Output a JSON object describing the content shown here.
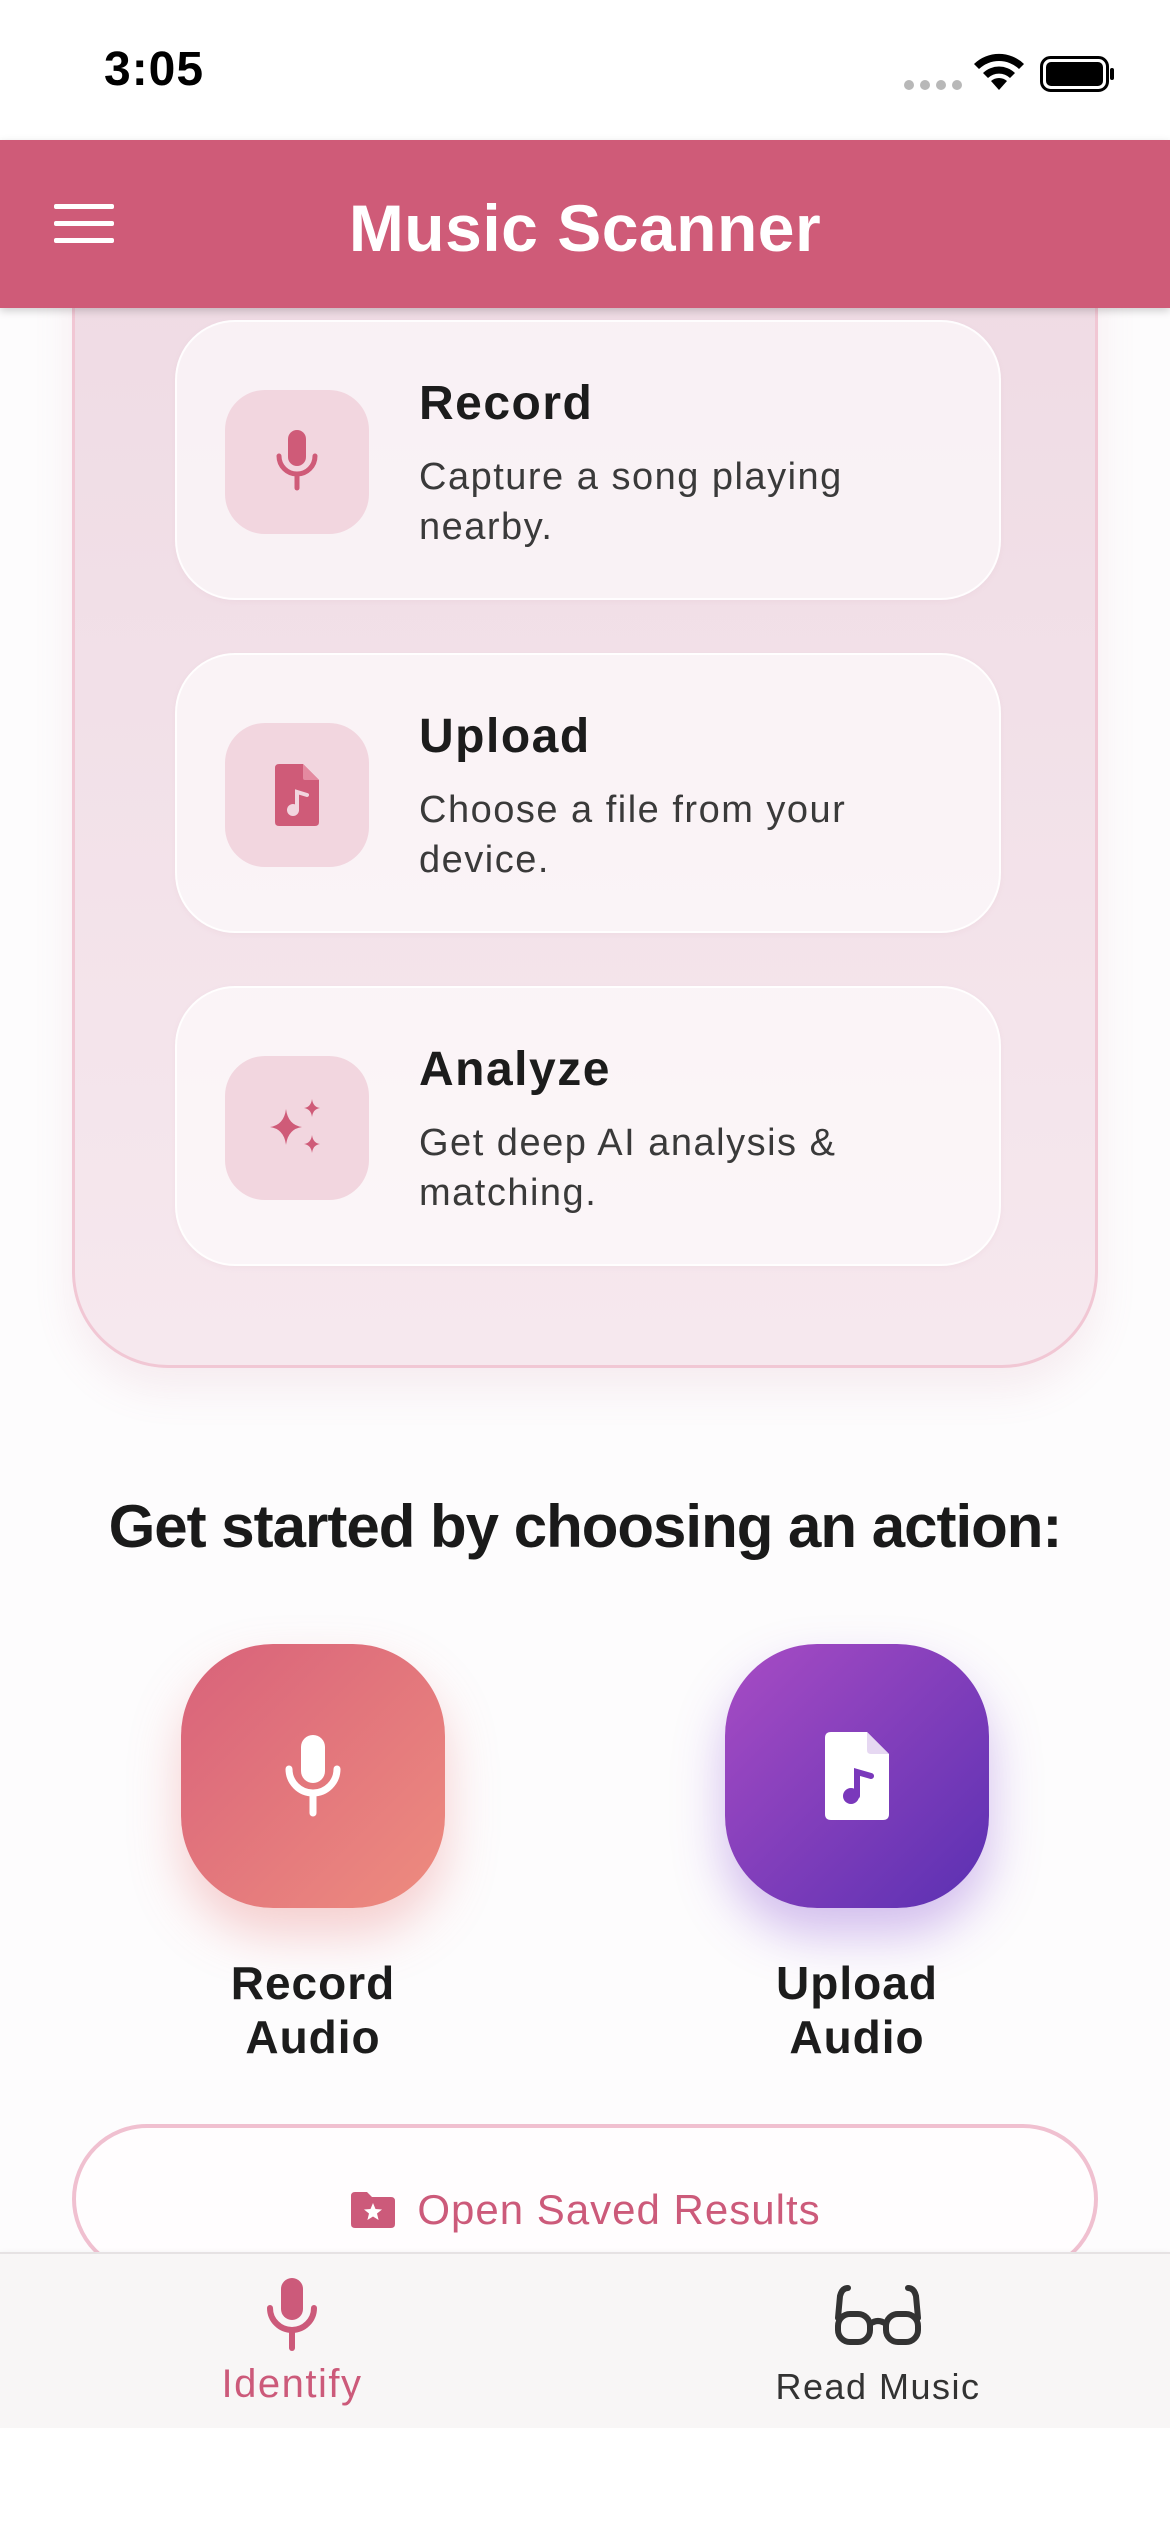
{
  "status_bar": {
    "time": "3:05"
  },
  "app_bar": {
    "title": "Music Scanner",
    "menu_icon": "hamburger-menu-icon"
  },
  "features": [
    {
      "title": "Record",
      "description": "Capture a song playing nearby.",
      "icon": "microphone-icon"
    },
    {
      "title": "Upload",
      "description": "Choose a file from your device.",
      "icon": "music-file-icon"
    },
    {
      "title": "Analyze",
      "description": "Get deep AI analysis & matching.",
      "icon": "sparkles-icon"
    }
  ],
  "prompt": "Get started by choosing an action:",
  "actions": {
    "record": {
      "label_line1": "Record",
      "label_line2": "Audio"
    },
    "upload": {
      "label_line1": "Upload",
      "label_line2": "Audio"
    }
  },
  "saved_results": {
    "label": "Open Saved Results",
    "icon": "folder-star-icon"
  },
  "bottom_nav": {
    "items": [
      {
        "label": "Identify",
        "icon": "microphone-icon",
        "active": true
      },
      {
        "label": "Read Music",
        "icon": "glasses-icon",
        "active": false
      }
    ]
  },
  "colors": {
    "primary": "#cf5b78",
    "record_gradient": [
      "#d8627a",
      "#ee8c7f"
    ],
    "upload_gradient": [
      "#a84cc4",
      "#5a30b2"
    ]
  }
}
